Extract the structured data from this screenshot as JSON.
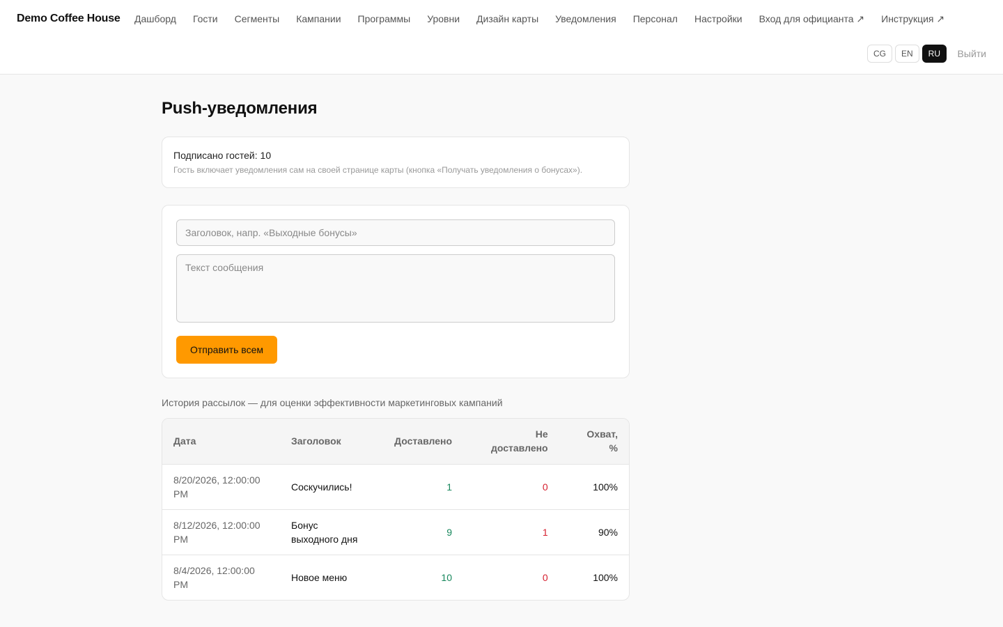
{
  "header": {
    "brand": "Demo Coffee House",
    "nav": [
      "Дашборд",
      "Гости",
      "Сегменты",
      "Кампании",
      "Программы",
      "Уровни",
      "Дизайн карты",
      "Уведомления",
      "Персонал",
      "Настройки",
      "Вход для официанта ↗",
      "Инструкция ↗"
    ],
    "languages": [
      "CG",
      "EN",
      "RU"
    ],
    "active_language": "RU",
    "logout": "Выйти"
  },
  "page": {
    "title": "Push-уведомления"
  },
  "subscribers": {
    "count_text": "Подписано гостей: 10",
    "hint": "Гость включает уведомления сам на своей странице карты (кнопка «Получать уведомления о бонусах»)."
  },
  "compose": {
    "title_placeholder": "Заголовок, напр. «Выходные бонусы»",
    "body_placeholder": "Текст сообщения",
    "send_label": "Отправить всем"
  },
  "history": {
    "title": "История рассылок — для оценки эффективности маркетинговых кампаний",
    "columns": [
      "Дата",
      "Заголовок",
      "Доставлено",
      "Не доставлено",
      "Охват, %"
    ],
    "rows": [
      {
        "date": "8/20/2026, 12:00:00 PM",
        "title": "Соскучились!",
        "delivered": "1",
        "failed": "0",
        "reach": "100%"
      },
      {
        "date": "8/12/2026, 12:00:00 PM",
        "title": "Бонус выходного дня",
        "delivered": "9",
        "failed": "1",
        "reach": "90%"
      },
      {
        "date": "8/4/2026, 12:00:00 PM",
        "title": "Новое меню",
        "delivered": "10",
        "failed": "0",
        "reach": "100%"
      }
    ]
  },
  "colors": {
    "accent": "#ff9900",
    "delivered": "#17875c",
    "failed": "#d6202f"
  }
}
